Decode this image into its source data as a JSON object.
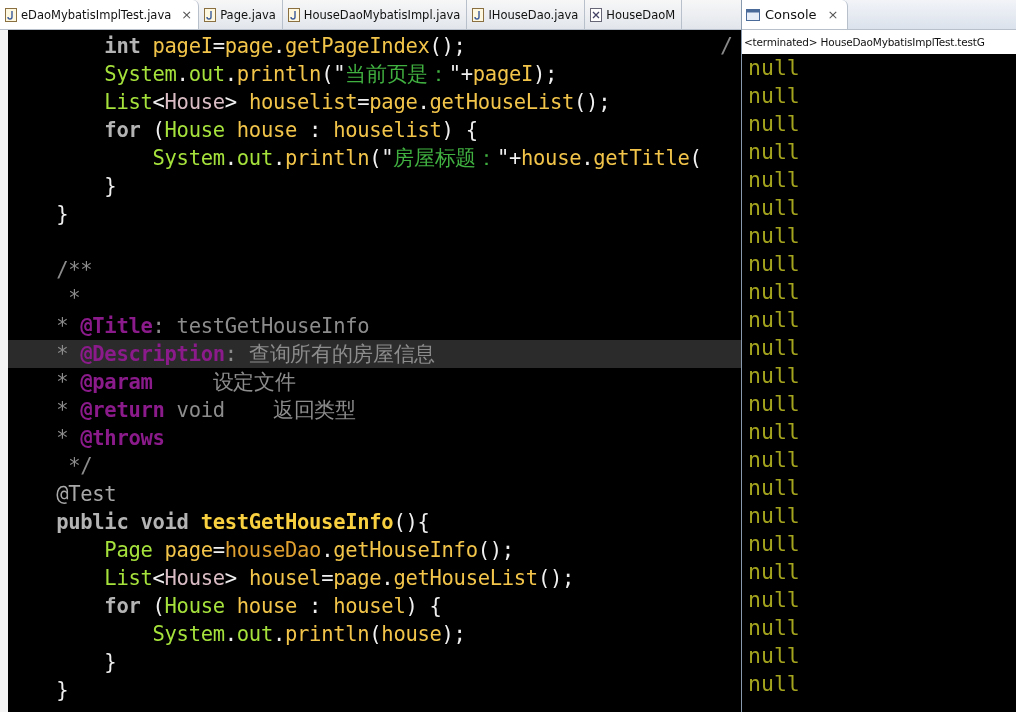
{
  "editor": {
    "tabs": [
      {
        "label": "eDaoMybatisImplTest.java",
        "kind": "java",
        "selected": true,
        "close": "×"
      },
      {
        "label": "Page.java",
        "kind": "java",
        "selected": false
      },
      {
        "label": "HouseDaoMybatisImpl.java",
        "kind": "java",
        "selected": false
      },
      {
        "label": "IHouseDao.java",
        "kind": "java",
        "selected": false
      },
      {
        "label": "HouseDaoM",
        "kind": "xml",
        "selected": false
      }
    ],
    "lines": [
      {
        "current": false,
        "tokens": [
          {
            "kind": "kw",
            "text": "        int"
          },
          {
            "kind": "var",
            "text": " pageI"
          },
          {
            "kind": "punct",
            "text": "="
          },
          {
            "kind": "var",
            "text": "page"
          },
          {
            "kind": "punct",
            "text": "."
          },
          {
            "kind": "method",
            "text": "getPageIndex"
          },
          {
            "kind": "punct",
            "text": "();"
          }
        ],
        "trailing": "/"
      },
      {
        "current": false,
        "tokens": [
          {
            "kind": "type",
            "text": "        System"
          },
          {
            "kind": "punct",
            "text": "."
          },
          {
            "kind": "type",
            "text": "out"
          },
          {
            "kind": "punct",
            "text": "."
          },
          {
            "kind": "method",
            "text": "println"
          },
          {
            "kind": "punct",
            "text": "(\""
          },
          {
            "kind": "str",
            "text": "当前页是："
          },
          {
            "kind": "punct",
            "text": "\"+"
          },
          {
            "kind": "var",
            "text": "pageI"
          },
          {
            "kind": "punct",
            "text": ");"
          }
        ]
      },
      {
        "current": false,
        "tokens": [
          {
            "kind": "type",
            "text": "        List"
          },
          {
            "kind": "punct",
            "text": "<"
          },
          {
            "kind": "generic",
            "text": "House"
          },
          {
            "kind": "punct",
            "text": "> "
          },
          {
            "kind": "var",
            "text": "houselist"
          },
          {
            "kind": "punct",
            "text": "="
          },
          {
            "kind": "var",
            "text": "page"
          },
          {
            "kind": "punct",
            "text": "."
          },
          {
            "kind": "method",
            "text": "getHouseList"
          },
          {
            "kind": "punct",
            "text": "();"
          }
        ]
      },
      {
        "current": false,
        "tokens": [
          {
            "kind": "kw",
            "text": "        for"
          },
          {
            "kind": "punct",
            "text": " ("
          },
          {
            "kind": "type",
            "text": "House"
          },
          {
            "kind": "var",
            "text": " house"
          },
          {
            "kind": "punct",
            "text": " : "
          },
          {
            "kind": "var",
            "text": "houselist"
          },
          {
            "kind": "punct",
            "text": ") {"
          }
        ]
      },
      {
        "current": false,
        "tokens": [
          {
            "kind": "type",
            "text": "            System"
          },
          {
            "kind": "punct",
            "text": "."
          },
          {
            "kind": "type",
            "text": "out"
          },
          {
            "kind": "punct",
            "text": "."
          },
          {
            "kind": "method",
            "text": "println"
          },
          {
            "kind": "punct",
            "text": "(\""
          },
          {
            "kind": "str",
            "text": "房屋标题："
          },
          {
            "kind": "punct",
            "text": "\"+"
          },
          {
            "kind": "var",
            "text": "house"
          },
          {
            "kind": "punct",
            "text": "."
          },
          {
            "kind": "method",
            "text": "getTitle"
          },
          {
            "kind": "punct",
            "text": "("
          }
        ]
      },
      {
        "current": false,
        "tokens": [
          {
            "kind": "punct",
            "text": "        }"
          }
        ]
      },
      {
        "current": false,
        "tokens": [
          {
            "kind": "punct",
            "text": "    }"
          }
        ]
      },
      {
        "current": false
      },
      {
        "current": false,
        "tokens": [
          {
            "kind": "comment",
            "text": "    /**"
          }
        ]
      },
      {
        "current": false,
        "tokens": [
          {
            "kind": "comment",
            "text": "     *"
          }
        ]
      },
      {
        "current": false,
        "tokens": [
          {
            "kind": "comment",
            "text": "    * "
          },
          {
            "kind": "tag",
            "text": "@Title"
          },
          {
            "kind": "comment",
            "text": ": testGetHouseInfo"
          }
        ]
      },
      {
        "current": true,
        "tokens": [
          {
            "kind": "comment",
            "text": "    * "
          },
          {
            "kind": "tag",
            "text": "@Description"
          },
          {
            "kind": "comment",
            "text": ": 查询所有的房屋信息"
          }
        ]
      },
      {
        "current": false,
        "tokens": [
          {
            "kind": "comment",
            "text": "    * "
          },
          {
            "kind": "tag",
            "text": "@param"
          },
          {
            "kind": "comment",
            "text": "     设定文件"
          }
        ]
      },
      {
        "current": false,
        "tokens": [
          {
            "kind": "comment",
            "text": "    * "
          },
          {
            "kind": "tag",
            "text": "@return"
          },
          {
            "kind": "comment",
            "text": " void    返回类型"
          }
        ]
      },
      {
        "current": false,
        "tokens": [
          {
            "kind": "comment",
            "text": "    * "
          },
          {
            "kind": "tag",
            "text": "@throws"
          }
        ]
      },
      {
        "current": false,
        "tokens": [
          {
            "kind": "comment",
            "text": "     */"
          }
        ]
      },
      {
        "current": false,
        "tokens": [
          {
            "kind": "annot",
            "text": "    @Test"
          }
        ]
      },
      {
        "current": false,
        "tokens": [
          {
            "kind": "kw",
            "text": "    public void "
          },
          {
            "kind": "decl",
            "text": "testGetHouseInfo"
          },
          {
            "kind": "punct",
            "text": "(){"
          }
        ]
      },
      {
        "current": false,
        "tokens": [
          {
            "kind": "type",
            "text": "        Page"
          },
          {
            "kind": "var",
            "text": " page"
          },
          {
            "kind": "punct",
            "text": "="
          },
          {
            "kind": "field",
            "text": "houseDao"
          },
          {
            "kind": "punct",
            "text": "."
          },
          {
            "kind": "method",
            "text": "getHouseInfo"
          },
          {
            "kind": "punct",
            "text": "();"
          }
        ]
      },
      {
        "current": false,
        "tokens": [
          {
            "kind": "type",
            "text": "        List"
          },
          {
            "kind": "punct",
            "text": "<"
          },
          {
            "kind": "generic",
            "text": "House"
          },
          {
            "kind": "punct",
            "text": "> "
          },
          {
            "kind": "var",
            "text": "housel"
          },
          {
            "kind": "punct",
            "text": "="
          },
          {
            "kind": "var",
            "text": "page"
          },
          {
            "kind": "punct",
            "text": "."
          },
          {
            "kind": "method",
            "text": "getHouseList"
          },
          {
            "kind": "punct",
            "text": "();"
          }
        ]
      },
      {
        "current": false,
        "tokens": [
          {
            "kind": "kw",
            "text": "        for"
          },
          {
            "kind": "punct",
            "text": " ("
          },
          {
            "kind": "type",
            "text": "House"
          },
          {
            "kind": "var",
            "text": " house"
          },
          {
            "kind": "punct",
            "text": " : "
          },
          {
            "kind": "var",
            "text": "housel"
          },
          {
            "kind": "punct",
            "text": ") {"
          }
        ]
      },
      {
        "current": false,
        "tokens": [
          {
            "kind": "type",
            "text": "            System"
          },
          {
            "kind": "punct",
            "text": "."
          },
          {
            "kind": "type",
            "text": "out"
          },
          {
            "kind": "punct",
            "text": "."
          },
          {
            "kind": "method",
            "text": "println"
          },
          {
            "kind": "punct",
            "text": "("
          },
          {
            "kind": "var",
            "text": "house"
          },
          {
            "kind": "punct",
            "text": ");"
          }
        ]
      },
      {
        "current": false,
        "tokens": [
          {
            "kind": "punct",
            "text": "        }"
          }
        ]
      },
      {
        "current": false,
        "tokens": [
          {
            "kind": "punct",
            "text": "    }"
          }
        ]
      }
    ]
  },
  "console": {
    "tab": {
      "label": "Console",
      "close": "×",
      "selected": true
    },
    "status": "<terminated> HouseDaoMybatisImplTest.testG",
    "lines": [
      "null",
      "null",
      "null",
      "null",
      "null",
      "null",
      "null",
      "null",
      "null",
      "null",
      "null",
      "null",
      "null",
      "null",
      "null",
      "null",
      "null",
      "null",
      "null",
      "null",
      "null",
      "null",
      "null"
    ]
  }
}
